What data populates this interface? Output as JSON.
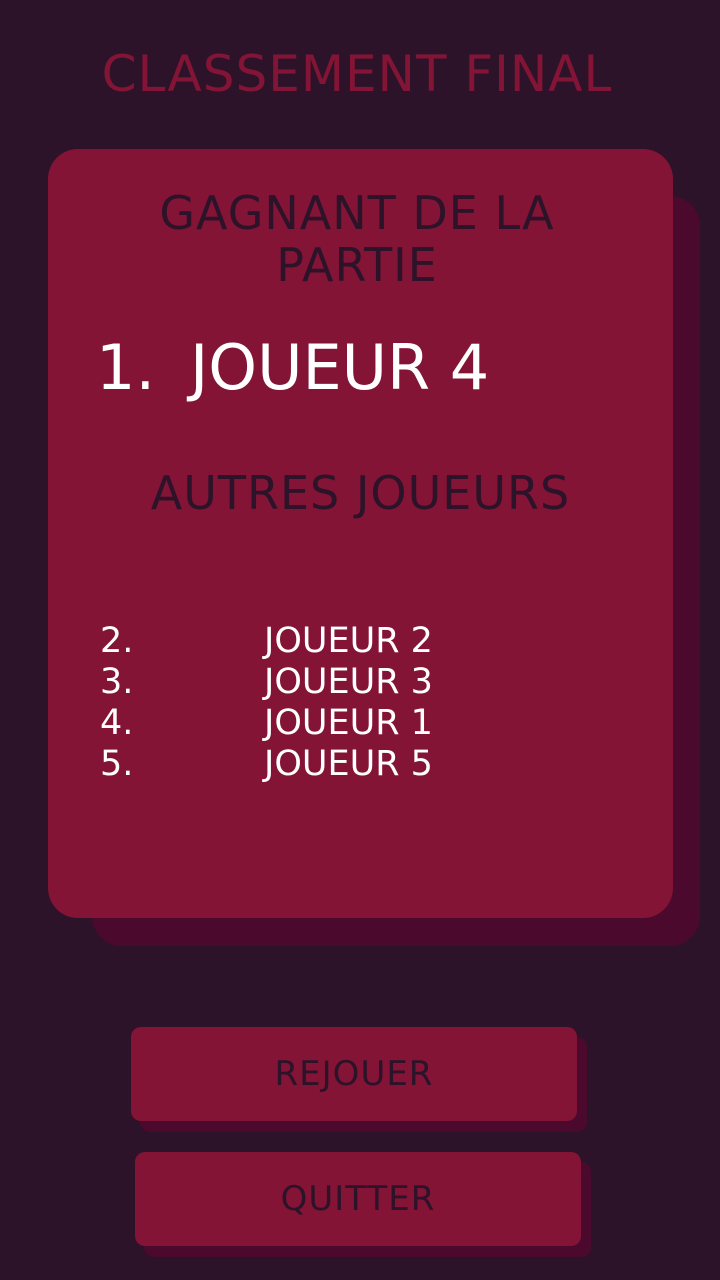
{
  "title": "CLASSEMENT FINAL",
  "winner": {
    "heading": "GAGNANT DE LA\nPARTIE",
    "rank": "1.",
    "name": "JOUEUR 4"
  },
  "others": {
    "heading": "AUTRES JOUEURS",
    "players": [
      {
        "rank": "2.",
        "name": "JOUEUR 2"
      },
      {
        "rank": "3.",
        "name": "JOUEUR 3"
      },
      {
        "rank": "4.",
        "name": "JOUEUR 1"
      },
      {
        "rank": "5.",
        "name": "JOUEUR 5"
      }
    ]
  },
  "buttons": {
    "replay_label": "REJOUER",
    "quit_label": "QUITTER"
  },
  "colors": {
    "background": "#2c1329",
    "card": "#831435",
    "shadow": "#4b0a2d",
    "highlight_text": "#ffffff"
  }
}
